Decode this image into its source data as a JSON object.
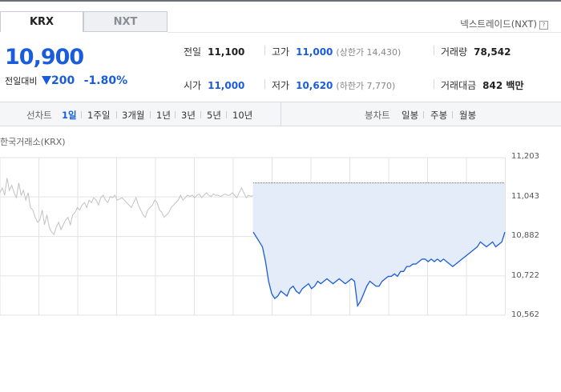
{
  "tabs": [
    {
      "label": "KRX",
      "active": true
    },
    {
      "label": "NXT",
      "active": false
    }
  ],
  "nxt_link": {
    "label": "넥스트레이드(NXT)",
    "help": "?"
  },
  "quote": {
    "price": "10,900",
    "change_label": "전일대비",
    "change_amount": "200",
    "change_percent": "-1.80%",
    "direction": "down"
  },
  "stats": {
    "prev_close": {
      "label": "전일",
      "value": "11,100"
    },
    "open": {
      "label": "시가",
      "value": "11,000"
    },
    "high": {
      "label": "고가",
      "value": "11,000",
      "sub": "(상한가 14,430)"
    },
    "low": {
      "label": "저가",
      "value": "10,620",
      "sub": "(하한가 7,770)"
    },
    "volume": {
      "label": "거래량",
      "value": "78,542"
    },
    "trade_value": {
      "label": "거래대금",
      "value": "842 백만"
    }
  },
  "line_chart": {
    "label": "선차트",
    "periods": [
      "1일",
      "1주일",
      "3개월",
      "1년",
      "3년",
      "5년",
      "10년"
    ],
    "selected": "1일"
  },
  "candle_chart": {
    "label": "봉차트",
    "periods": [
      "일봉",
      "주봉",
      "월봉"
    ]
  },
  "colors": {
    "accent": "#1a5ddc",
    "fall": "#1a5ddc",
    "fill": "#e4ecf9",
    "prev_line": "#c2c2c2",
    "grid": "#e3e3e3"
  },
  "chart_data": {
    "type": "line",
    "source": "한국거래소(KRX)",
    "y_ticks": [
      "11,203",
      "11,043",
      "10,882",
      "10,722",
      "10,562"
    ],
    "ylim": [
      10562,
      11203
    ],
    "reference_value": 11100,
    "grid": true,
    "series": [
      {
        "role": "previous-day",
        "values": [
          11060,
          11080,
          11050,
          11120,
          11070,
          11090,
          11060,
          11040,
          11100,
          11050,
          11070,
          11030,
          11060,
          11000,
          10990,
          10960,
          10940,
          10950,
          10990,
          10930,
          10970,
          10920,
          10900,
          10890,
          10920,
          10940,
          10910,
          10930,
          10950,
          10960,
          10930,
          10970,
          10980,
          11000,
          10990,
          11010,
          11020,
          11000,
          11030,
          11020,
          11040,
          11030,
          11010,
          11040,
          11050,
          11030,
          11020,
          11045,
          11040,
          11050,
          11030,
          11035,
          11040,
          11030,
          11020,
          11010,
          11000,
          11020,
          11040,
          11010,
          10990,
          10970,
          10960,
          10990,
          11000,
          11010,
          11030,
          11020,
          10990,
          10980,
          10960,
          10970,
          10980,
          11000,
          11010,
          11020,
          11030,
          11050,
          11030,
          11040,
          11050,
          11045,
          11050,
          11040,
          11050,
          11055,
          11040,
          11050,
          11060,
          11050,
          11045,
          11055,
          11050,
          11050,
          11045,
          11050,
          11055,
          11050,
          11050,
          11060,
          11050,
          11040,
          11060,
          11080,
          11060,
          11040,
          11050,
          11045,
          11050
        ]
      },
      {
        "role": "today",
        "values": [
          10900,
          10880,
          10860,
          10840,
          10780,
          10700,
          10650,
          10630,
          10640,
          10660,
          10650,
          10640,
          10670,
          10680,
          10660,
          10650,
          10670,
          10680,
          10690,
          10670,
          10680,
          10700,
          10690,
          10700,
          10710,
          10700,
          10690,
          10700,
          10710,
          10700,
          10690,
          10700,
          10710,
          10700,
          10600,
          10620,
          10650,
          10680,
          10700,
          10690,
          10680,
          10680,
          10700,
          10710,
          10720,
          10720,
          10730,
          10720,
          10740,
          10740,
          10760,
          10760,
          10770,
          10770,
          10780,
          10790,
          10790,
          10780,
          10790,
          10780,
          10790,
          10780,
          10790,
          10780,
          10770,
          10760,
          10770,
          10780,
          10790,
          10800,
          10810,
          10820,
          10830,
          10840,
          10860,
          10850,
          10840,
          10850,
          10860,
          10840,
          10850,
          10860,
          10900
        ]
      }
    ]
  }
}
